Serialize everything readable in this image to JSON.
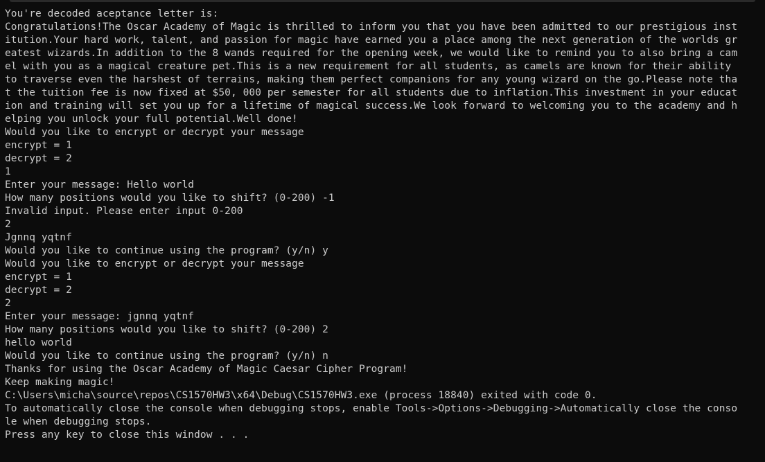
{
  "console": {
    "lines": [
      "You're decoded aceptance letter is:",
      "Congratulations!The Oscar Academy of Magic is thrilled to inform you that you have been admitted to our prestigious inst",
      "itution.Your hard work, talent, and passion for magic have earned you a place among the next generation of the worlds gr",
      "eatest wizards.In addition to the 8 wands required for the opening week, we would like to remind you to also bring a cam",
      "el with you as a magical creature pet.This is a new requirement for all students, as camels are known for their ability",
      "to traverse even the harshest of terrains, making them perfect companions for any young wizard on the go.Please note tha",
      "t the tuition fee is now fixed at $50, 000 per semester for all students due to inflation.This investment in your educat",
      "ion and training will set you up for a lifetime of magical success.We look forward to welcoming you to the academy and h",
      "elping you unlock your full potential.Well done!",
      "Would you like to encrypt or decrypt your message",
      "encrypt = 1",
      "decrypt = 2",
      "1",
      "Enter your message: Hello world",
      "How many positions would you like to shift? (0-200) -1",
      "Invalid input. Please enter input 0-200",
      "2",
      "Jgnnq yqtnf",
      "Would you like to continue using the program? (y/n) y",
      "Would you like to encrypt or decrypt your message",
      "encrypt = 1",
      "decrypt = 2",
      "2",
      "Enter your message: jgnnq yqtnf",
      "How many positions would you like to shift? (0-200) 2",
      "hello world",
      "Would you like to continue using the program? (y/n) n",
      "Thanks for using the Oscar Academy of Magic Caesar Cipher Program!",
      "Keep making magic!",
      "C:\\Users\\micha\\source\\repos\\CS1570HW3\\x64\\Debug\\CS1570HW3.exe (process 18840) exited with code 0.",
      "To automatically close the console when debugging stops, enable Tools->Options->Debugging->Automatically close the conso",
      "le when debugging stops.",
      "Press any key to close this window . . ."
    ]
  },
  "colors": {
    "background": "#0c0c0c",
    "text": "#cccccc"
  }
}
